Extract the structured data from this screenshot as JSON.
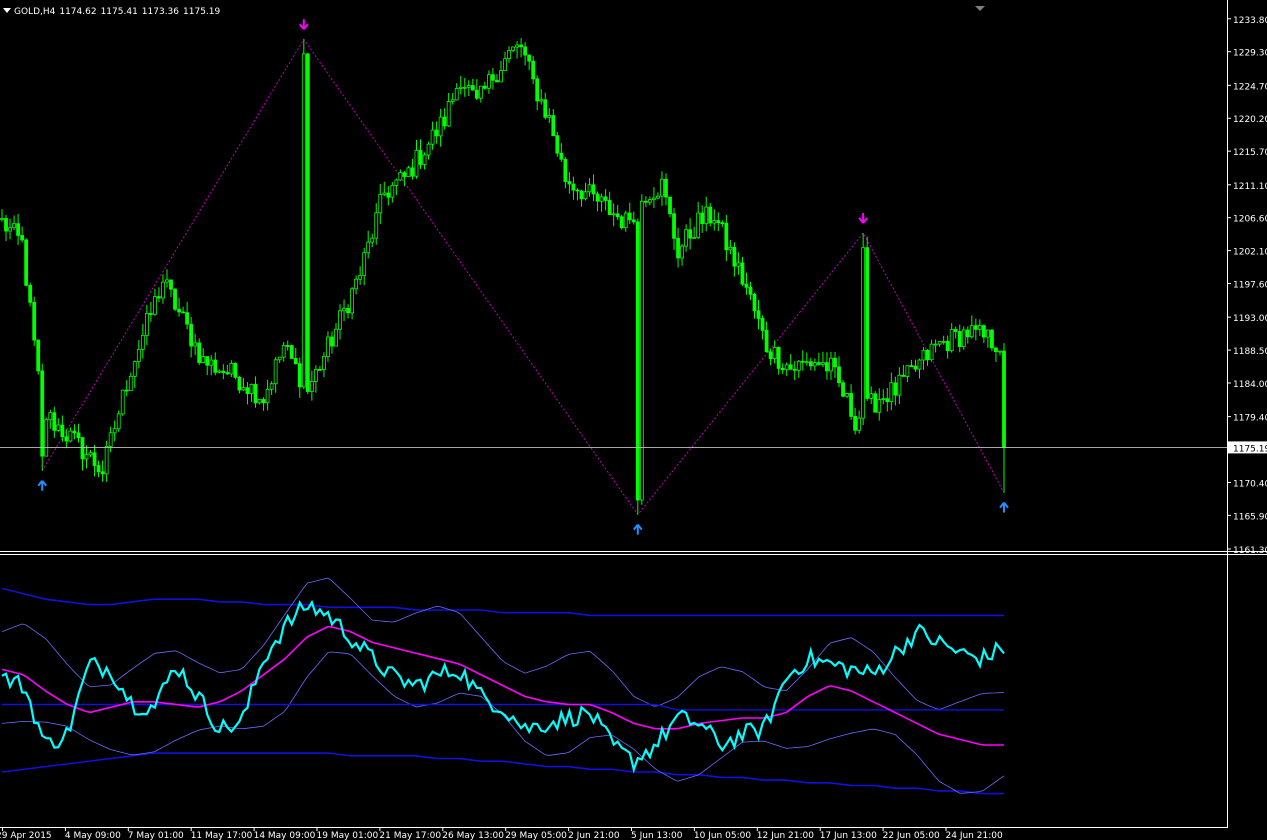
{
  "header": {
    "symbol_timeframe": "GOLD,H4",
    "open": "1174.62",
    "high": "1175.41",
    "low": "1173.36",
    "close": "1175.19"
  },
  "current_price_label": "1175.19",
  "colors": {
    "background": "#000000",
    "candle": "#00ff00",
    "zigzag": "#c000c0",
    "up_arrow": "#1e90ff",
    "down_arrow": "#ff00ff",
    "oscillator": "#00ffff",
    "oscillator_ma": "#ff00ff",
    "band_outer": "#1010e0",
    "band_inner": "#6a6aff",
    "axis_text": "#ffffff",
    "border": "#ffffff"
  },
  "chart_data": [
    {
      "type": "candlestick",
      "symbol": "GOLD",
      "timeframe": "H4",
      "ylim": [
        1161.3,
        1235.0
      ],
      "y_ticks": [
        "1233.80",
        "1229.30",
        "1224.70",
        "1220.20",
        "1215.70",
        "1211.10",
        "1206.60",
        "1202.10",
        "1197.60",
        "1193.00",
        "1188.50",
        "1184.00",
        "1179.40",
        "1175.19",
        "1170.40",
        "1165.90",
        "1161.30"
      ],
      "x_ticks": [
        "29 Apr 2015",
        "4 May 09:00",
        "7 May 01:00",
        "11 May 17:00",
        "14 May 09:00",
        "19 May 01:00",
        "21 May 17:00",
        "26 May 13:00",
        "29 May 05:00",
        "2 Jun 21:00",
        "5 Jun 13:00",
        "10 Jun 05:00",
        "12 Jun 21:00",
        "17 Jun 13:00",
        "22 Jun 05:00",
        "24 Jun 21:00"
      ],
      "bars_count": 250,
      "close_path_keypoints": [
        [
          0,
          1206
        ],
        [
          5,
          1203
        ],
        [
          10,
          1180
        ],
        [
          18,
          1176
        ],
        [
          25,
          1172
        ],
        [
          32,
          1186
        ],
        [
          40,
          1198
        ],
        [
          50,
          1187
        ],
        [
          58,
          1185
        ],
        [
          65,
          1182
        ],
        [
          70,
          1189
        ],
        [
          76,
          1183
        ],
        [
          82,
          1190
        ],
        [
          89,
          1199
        ],
        [
          95,
          1210
        ],
        [
          100,
          1212
        ],
        [
          105,
          1216
        ],
        [
          110,
          1220
        ],
        [
          114,
          1226
        ],
        [
          118,
          1222
        ],
        [
          122,
          1226
        ],
        [
          126,
          1229
        ],
        [
          129,
          1230
        ],
        [
          132,
          1225
        ],
        [
          136,
          1220
        ],
        [
          140,
          1212
        ],
        [
          145,
          1210
        ],
        [
          150,
          1208
        ],
        [
          155,
          1206
        ],
        [
          160,
          1210
        ],
        [
          164,
          1211
        ],
        [
          168,
          1202
        ],
        [
          173,
          1206
        ],
        [
          177,
          1207
        ],
        [
          180,
          1203
        ],
        [
          185,
          1197
        ],
        [
          190,
          1189
        ],
        [
          196,
          1186
        ],
        [
          202,
          1187
        ],
        [
          206,
          1186
        ],
        [
          212,
          1179
        ],
        [
          218,
          1182
        ],
        [
          222,
          1183
        ],
        [
          227,
          1186
        ],
        [
          232,
          1189
        ],
        [
          236,
          1190
        ],
        [
          240,
          1191
        ],
        [
          245,
          1190
        ],
        [
          249,
          1189
        ]
      ],
      "zigzag": [
        {
          "bar": 10,
          "price": 1172.0
        },
        {
          "bar": 75,
          "price": 1231.0
        },
        {
          "bar": 158,
          "price": 1166.0
        },
        {
          "bar": 214,
          "price": 1204.5
        },
        {
          "bar": 249,
          "price": 1169.0
        }
      ],
      "signals": [
        {
          "type": "up",
          "bar": 10,
          "price": 1172.0
        },
        {
          "type": "down",
          "bar": 75,
          "price": 1231.0
        },
        {
          "type": "up",
          "bar": 158,
          "price": 1166.0
        },
        {
          "type": "down",
          "bar": 214,
          "price": 1204.5
        },
        {
          "type": "up",
          "bar": 249,
          "price": 1169.0
        }
      ],
      "current_price": 1175.19
    },
    {
      "type": "line",
      "name": "",
      "ylim": [
        0,
        100
      ],
      "series": [
        {
          "name": "",
          "values": [
            55,
            52,
            30,
            34,
            60,
            58,
            45,
            44,
            60,
            48,
            36,
            38,
            62,
            74,
            82,
            78,
            70,
            62,
            55,
            52,
            56,
            58,
            48,
            44,
            36,
            38,
            40,
            42,
            30,
            24,
            30,
            40,
            38,
            30,
            34,
            36,
            55,
            62,
            60,
            58,
            56,
            64,
            72,
            68,
            64,
            62,
            66
          ]
        },
        {
          "name": "",
          "values": [
            58,
            56,
            50,
            45,
            42,
            44,
            46,
            46,
            45,
            44,
            46,
            50,
            56,
            62,
            70,
            74,
            72,
            68,
            66,
            64,
            62,
            60,
            56,
            52,
            48,
            46,
            45,
            45,
            42,
            38,
            36,
            36,
            38,
            39,
            40,
            40,
            42,
            48,
            52,
            50,
            46,
            42,
            38,
            34,
            32,
            30,
            30
          ]
        },
        {
          "name": "",
          "values": [
            88,
            86,
            84,
            83,
            82,
            82,
            83,
            84,
            84,
            84,
            83,
            83,
            82,
            82,
            82,
            81,
            81,
            81,
            81,
            80,
            80,
            80,
            80,
            79,
            79,
            79,
            79,
            78,
            78,
            78,
            78,
            78,
            78,
            78,
            78,
            78,
            78,
            78,
            78,
            78,
            78,
            78,
            78,
            78,
            78,
            78,
            78
          ]
        },
        {
          "name": "",
          "values": [
            20,
            21,
            22,
            23,
            24,
            25,
            26,
            27,
            27,
            27,
            27,
            27,
            27,
            27,
            27,
            27,
            26,
            26,
            26,
            26,
            25,
            25,
            24,
            24,
            23,
            22,
            22,
            21,
            21,
            20,
            20,
            19,
            19,
            18,
            18,
            17,
            17,
            16,
            16,
            15,
            15,
            14,
            14,
            13,
            13,
            12,
            12
          ]
        }
      ]
    }
  ]
}
